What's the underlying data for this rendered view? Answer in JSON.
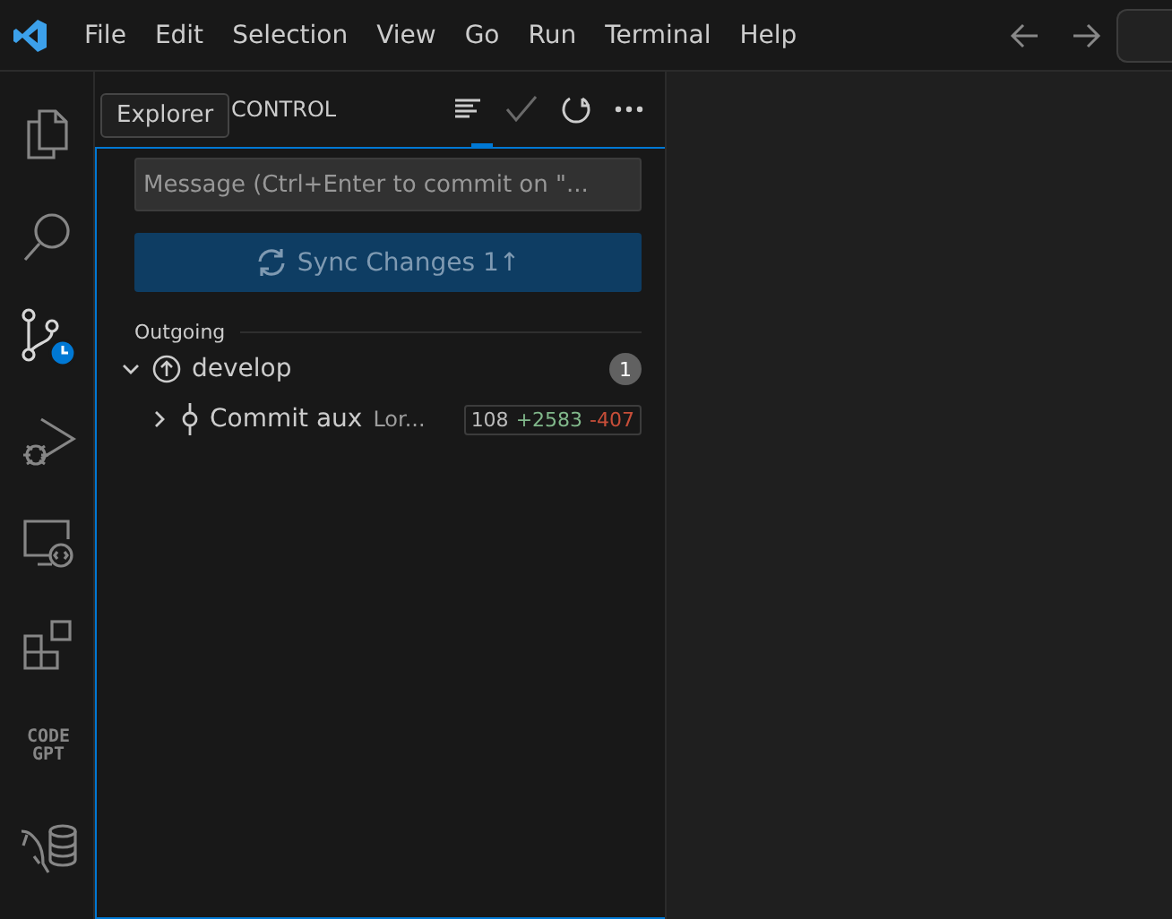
{
  "menu_bar": {
    "items": [
      "File",
      "Edit",
      "Selection",
      "View",
      "Go",
      "Run",
      "Terminal",
      "Help"
    ]
  },
  "activity_bar": {
    "items": [
      {
        "kind": "explorer",
        "selected": false
      },
      {
        "kind": "search",
        "selected": false
      },
      {
        "kind": "scm",
        "selected": true
      },
      {
        "kind": "debug",
        "selected": false
      },
      {
        "kind": "remote",
        "selected": false
      },
      {
        "kind": "extensions",
        "selected": false
      },
      {
        "kind": "codegpt",
        "selected": false,
        "label": [
          "CODE",
          "GPT"
        ]
      },
      {
        "kind": "database",
        "selected": false
      }
    ]
  },
  "tooltip": {
    "text": "Explorer"
  },
  "sidebar": {
    "title": "CONTROL",
    "commit_message": {
      "placeholder": "Message (Ctrl+Enter to commit on \"..."
    },
    "sync_button": {
      "label": "Sync Changes 1↑"
    },
    "section": {
      "title": "Outgoing",
      "branch": {
        "name": "develop",
        "expanded": true,
        "count": "1",
        "commits": [
          {
            "title": "Commit aux",
            "description": "Lor...",
            "expanded": false,
            "files": "108",
            "insertions": "+2583",
            "deletions": "-407"
          }
        ]
      }
    }
  }
}
